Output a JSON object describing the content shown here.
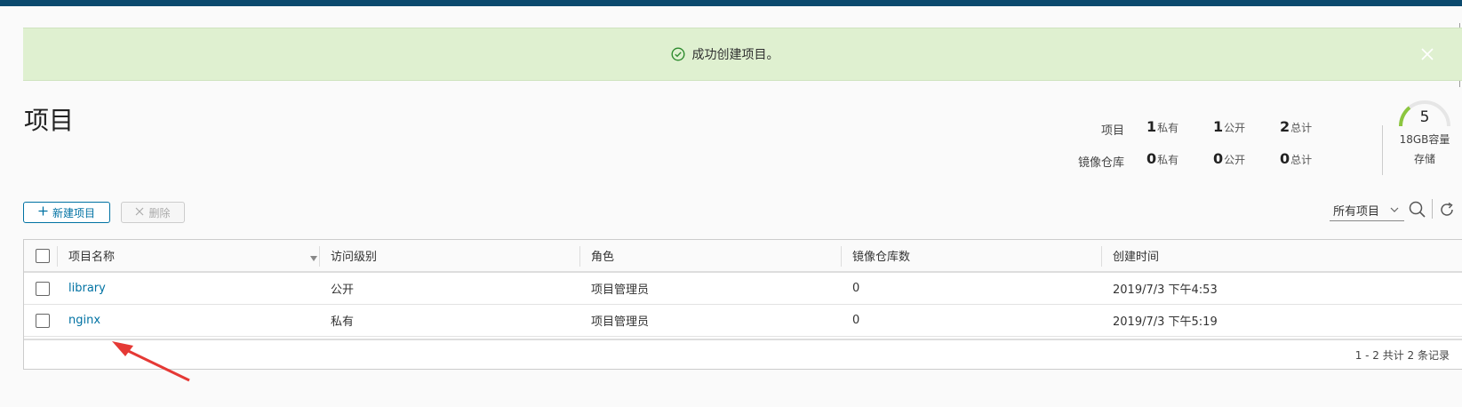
{
  "alert": {
    "message": "成功创建项目。"
  },
  "page": {
    "title": "项目"
  },
  "stats": {
    "rows": [
      {
        "label": "项目",
        "private_num": "1",
        "private_unit": "私有",
        "public_num": "1",
        "public_unit": "公开",
        "total_num": "2",
        "total_unit": "总计"
      },
      {
        "label": "镜像仓库",
        "private_num": "0",
        "private_unit": "私有",
        "public_num": "0",
        "public_unit": "公开",
        "total_num": "0",
        "total_unit": "总计"
      }
    ]
  },
  "storage": {
    "count": "5",
    "capacity": "18GB容量",
    "label": "存储"
  },
  "toolbar": {
    "new_label": "新建项目",
    "delete_label": "删除",
    "filter_value": "所有项目"
  },
  "table": {
    "columns": [
      "项目名称",
      "访问级别",
      "角色",
      "镜像仓库数",
      "创建时间"
    ],
    "rows": [
      {
        "name": "library",
        "access": "公开",
        "role": "项目管理员",
        "repos": "0",
        "created": "2019/7/3 下午4:53"
      },
      {
        "name": "nginx",
        "access": "私有",
        "role": "项目管理员",
        "repos": "0",
        "created": "2019/7/3 下午5:19"
      }
    ],
    "footer": "1 - 2 共计 2 条记录"
  },
  "colors": {
    "accent": "#0072a3",
    "success_bg": "#dff0d0",
    "topbar": "#0b4a6e",
    "arrow": "#e53935",
    "gauge": "#8cc63f"
  }
}
